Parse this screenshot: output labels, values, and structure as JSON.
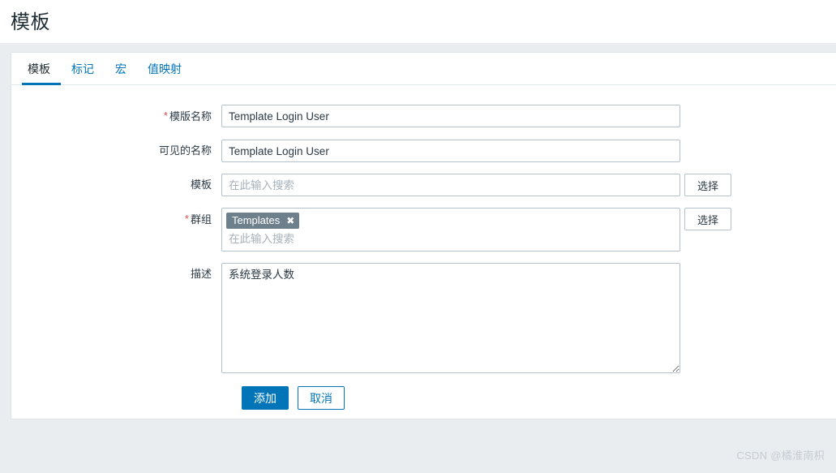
{
  "header": {
    "title": "模板"
  },
  "tabs": [
    {
      "label": "模板",
      "active": true
    },
    {
      "label": "标记",
      "active": false
    },
    {
      "label": "宏",
      "active": false
    },
    {
      "label": "值映射",
      "active": false
    }
  ],
  "form": {
    "template_name": {
      "label": "模版名称",
      "required": true,
      "value": "Template Login User"
    },
    "visible_name": {
      "label": "可见的名称",
      "required": false,
      "value": "Template Login User"
    },
    "templates": {
      "label": "模板",
      "required": false,
      "value": "",
      "placeholder": "在此输入搜索",
      "select_button": "选择"
    },
    "groups": {
      "label": "群组",
      "required": true,
      "chips": [
        {
          "label": "Templates",
          "remove_icon": "✖"
        }
      ],
      "placeholder": "在此输入搜索",
      "select_button": "选择"
    },
    "description": {
      "label": "描述",
      "required": false,
      "value": "系统登录人数"
    }
  },
  "actions": {
    "submit_label": "添加",
    "cancel_label": "取消"
  },
  "watermark": {
    "text": "CSDN @橘淮南枳"
  },
  "colors": {
    "accent": "#0275b8",
    "required_star": "#d44b4b",
    "chip_bg": "#6f808d",
    "page_bg": "#e9edf0"
  }
}
